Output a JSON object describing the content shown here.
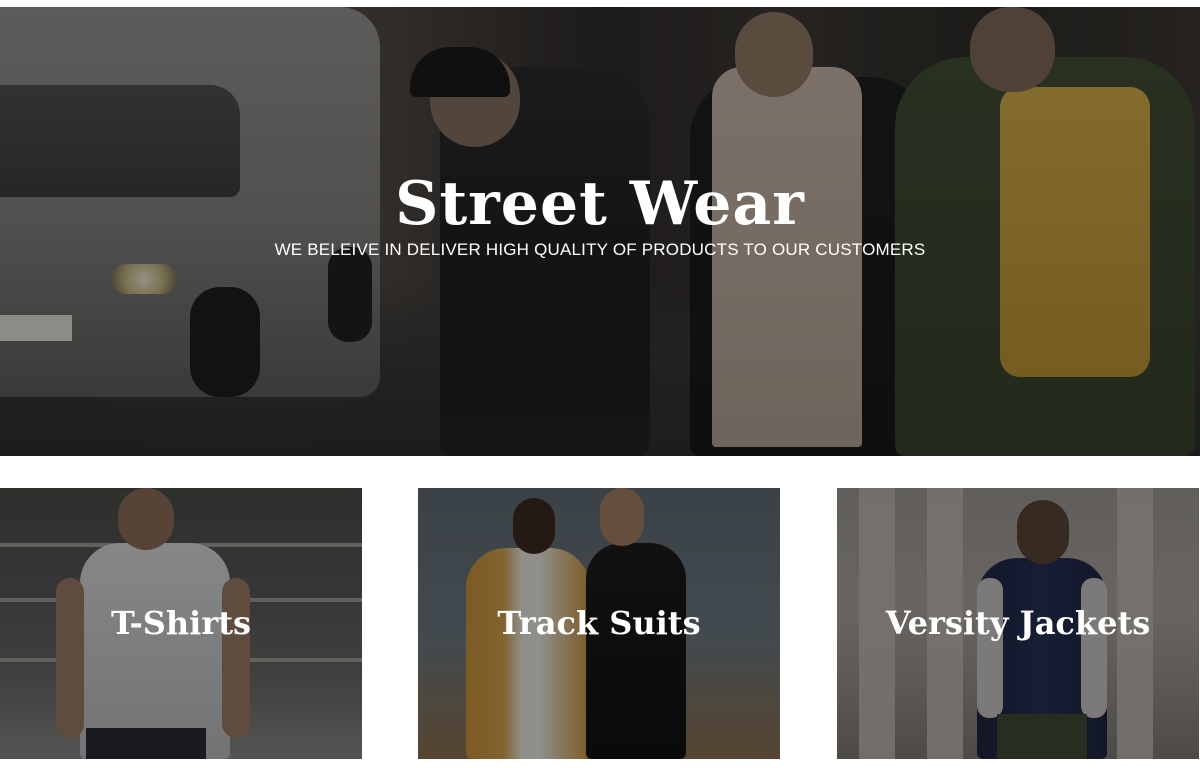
{
  "hero": {
    "title": "Street Wear",
    "subtitle": "WE BELEIVE IN DELIVER HIGH QUALITY OF PRODUCTS TO OUR CUSTOMERS"
  },
  "categories": [
    {
      "label": "T-Shirts"
    },
    {
      "label": "Track Suits"
    },
    {
      "label": "Versity Jackets"
    }
  ]
}
